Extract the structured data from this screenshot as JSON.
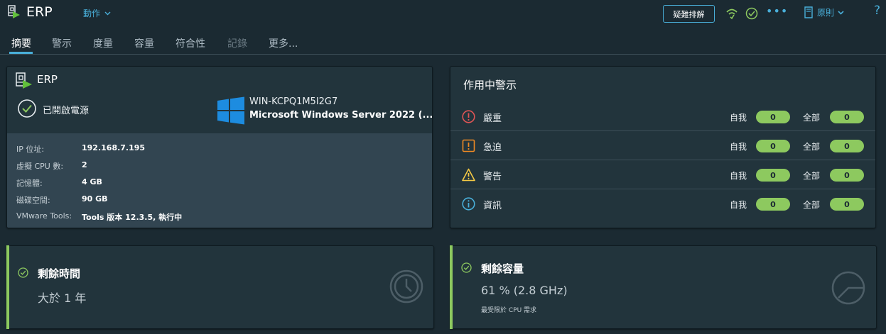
{
  "header": {
    "vm_name": "ERP",
    "actions_label": "動作",
    "troubleshoot_label": "疑難排解",
    "policy_label": "原則",
    "help_symbol": "?"
  },
  "tabs": [
    {
      "label": "摘要",
      "state": "active"
    },
    {
      "label": "警示",
      "state": "normal"
    },
    {
      "label": "度量",
      "state": "normal"
    },
    {
      "label": "容量",
      "state": "normal"
    },
    {
      "label": "符合性",
      "state": "normal"
    },
    {
      "label": "記錄",
      "state": "disabled"
    },
    {
      "label": "更多...",
      "state": "normal"
    }
  ],
  "summary_card": {
    "title": "ERP",
    "power_state": "已開啟電源",
    "host_name": "WIN-KCPQ1M5I2G7",
    "os_name": "Microsoft Windows Server 2022 (...",
    "properties": [
      {
        "label": "IP 位址:",
        "value": "192.168.7.195"
      },
      {
        "label": "虛擬 CPU 數:",
        "value": "2"
      },
      {
        "label": "記憶體:",
        "value": "4 GB"
      },
      {
        "label": "磁碟空間:",
        "value": "90 GB"
      },
      {
        "label": "VMware Tools:",
        "value": "Tools 版本 12.3.5, 執行中"
      }
    ]
  },
  "alerts_card": {
    "title": "作用中警示",
    "self_label": "自我",
    "all_label": "全部",
    "rows": [
      {
        "label": "嚴重",
        "icon": "critical-icon",
        "color": "#e05555",
        "self": "0",
        "all": "0"
      },
      {
        "label": "急迫",
        "icon": "immediate-icon",
        "color": "#f08a24",
        "self": "0",
        "all": "0"
      },
      {
        "label": "警告",
        "icon": "warning-icon",
        "color": "#f5c945",
        "self": "0",
        "all": "0"
      },
      {
        "label": "資訊",
        "icon": "info-icon",
        "color": "#49afd9",
        "self": "0",
        "all": "0"
      }
    ]
  },
  "time_remaining": {
    "title": "剩餘時間",
    "value": "大於 1 年"
  },
  "capacity_remaining": {
    "title": "剩餘容量",
    "value": "61 % (2.8 GHz)",
    "note": "最受限於 CPU 需求"
  },
  "colors": {
    "accent": "#49afd9",
    "ok_green": "#8dc95f",
    "background": "#1b2a32",
    "card": "#22343c"
  }
}
